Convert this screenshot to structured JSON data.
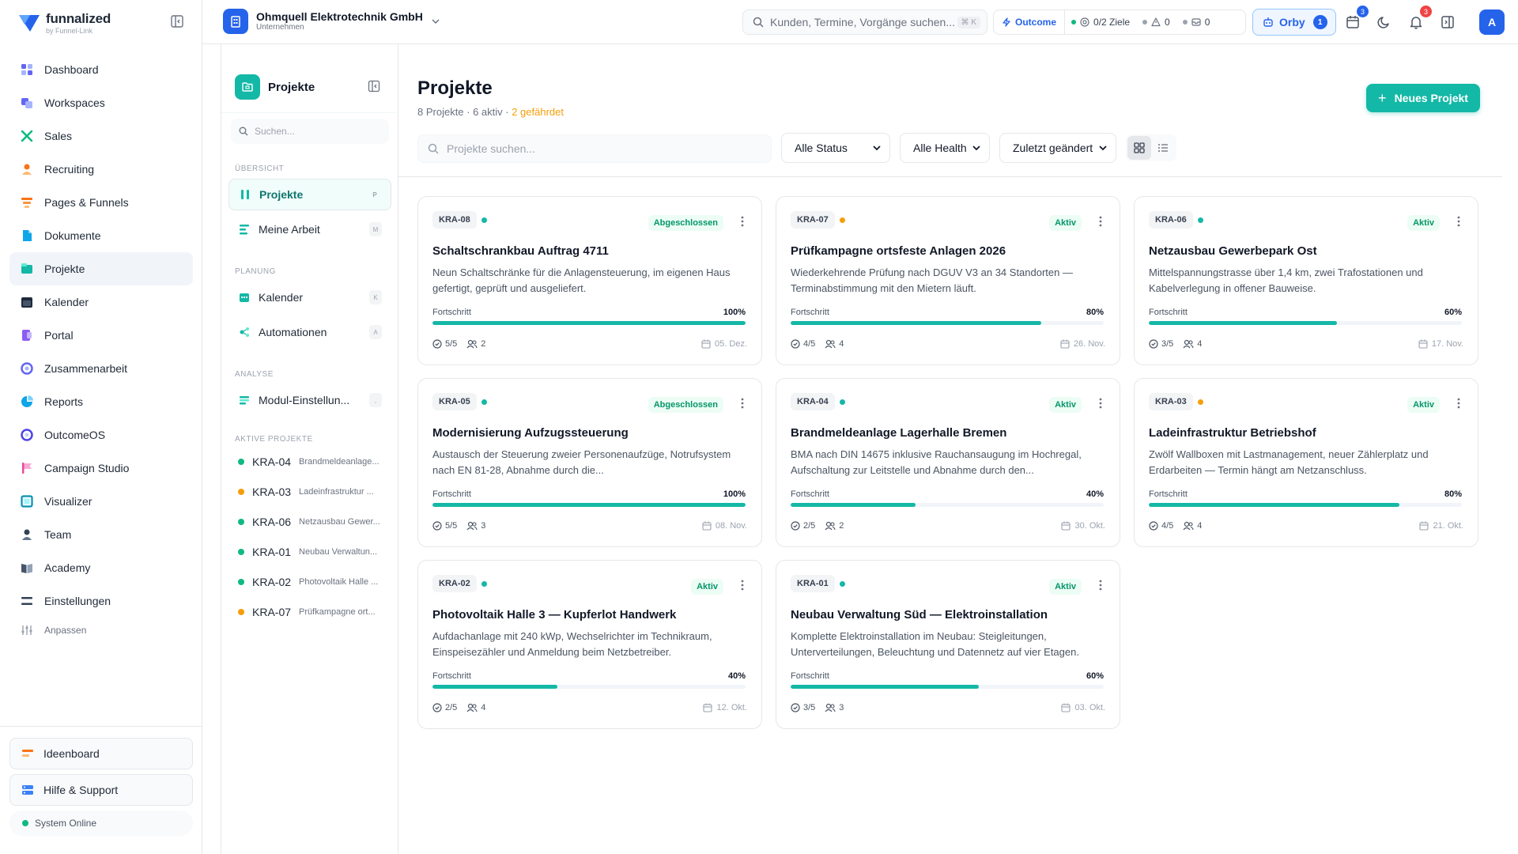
{
  "brand": {
    "name": "funnalized",
    "sub": "by Funnel-Link"
  },
  "nav": [
    {
      "label": "Dashboard",
      "icon": "dashboard-icon"
    },
    {
      "label": "Workspaces",
      "icon": "workspaces-icon"
    },
    {
      "label": "Sales",
      "icon": "sales-icon"
    },
    {
      "label": "Recruiting",
      "icon": "recruiting-icon"
    },
    {
      "label": "Pages & Funnels",
      "icon": "funnel-icon"
    },
    {
      "label": "Dokumente",
      "icon": "document-icon"
    },
    {
      "label": "Projekte",
      "icon": "projects-icon"
    },
    {
      "label": "Kalender",
      "icon": "calendar-icon"
    },
    {
      "label": "Portal",
      "icon": "portal-icon"
    },
    {
      "label": "Zusammenarbeit",
      "icon": "collaboration-icon"
    },
    {
      "label": "Reports",
      "icon": "reports-icon"
    },
    {
      "label": "OutcomeOS",
      "icon": "outcome-icon"
    },
    {
      "label": "Campaign Studio",
      "icon": "campaign-icon"
    },
    {
      "label": "Visualizer",
      "icon": "visualizer-icon"
    },
    {
      "label": "Team",
      "icon": "team-icon"
    },
    {
      "label": "Academy",
      "icon": "academy-icon"
    },
    {
      "label": "Einstellungen",
      "icon": "settings-icon"
    },
    {
      "label": "Anpassen",
      "icon": "customize-icon"
    }
  ],
  "sidebar_bottom": {
    "ideenboard": "Ideenboard",
    "help": "Hilfe & Support",
    "system": "System Online"
  },
  "topbar": {
    "company_name": "Ohmquell Elektrotechnik GmbH",
    "company_sub": "Unternehmen",
    "search_placeholder": "Kunden, Termine, Vorgänge suchen...",
    "search_shortcut": "⌘ K",
    "outcome": "Outcome",
    "goals": "0/2 Ziele",
    "warnings": "0",
    "messages": "0",
    "orby": "Orby",
    "orby_count": "1",
    "calendar_badge": "3",
    "notif_badge": "3",
    "avatar": "A"
  },
  "sub_sidebar": {
    "title": "Projekte",
    "search_placeholder": "Suchen...",
    "sections": {
      "overview": "Übersicht",
      "planning": "Planung",
      "analysis": "Analyse",
      "active": "Aktive Projekte"
    },
    "items": {
      "projekte": {
        "label": "Projekte",
        "key": "P"
      },
      "meine_arbeit": {
        "label": "Meine Arbeit",
        "key": "M"
      },
      "kalender": {
        "label": "Kalender",
        "key": "K"
      },
      "automationen": {
        "label": "Automationen",
        "key": "A"
      },
      "modul": {
        "label": "Modul-Einstellun...",
        "key": ","
      }
    },
    "active_projects": [
      {
        "code": "KRA-04",
        "name": "Brandmeldeanlage...",
        "color": "#10b981"
      },
      {
        "code": "KRA-03",
        "name": "Ladeinfrastruktur ...",
        "color": "#f59e0b"
      },
      {
        "code": "KRA-06",
        "name": "Netzausbau Gewer...",
        "color": "#10b981"
      },
      {
        "code": "KRA-01",
        "name": "Neubau Verwaltun...",
        "color": "#10b981"
      },
      {
        "code": "KRA-02",
        "name": "Photovoltaik Halle ...",
        "color": "#10b981"
      },
      {
        "code": "KRA-07",
        "name": "Prüfkampagne ort...",
        "color": "#f59e0b"
      }
    ]
  },
  "main": {
    "title": "Projekte",
    "subtitle_prefix": "8 Projekte · 6 aktiv · ",
    "subtitle_warn": "2 gefährdet",
    "new_button": "Neues Projekt",
    "search_placeholder": "Projekte suchen...",
    "filter_status": "Alle Status",
    "filter_health": "Alle Health",
    "sort": "Zuletzt geändert",
    "progress_label": "Fortschritt"
  },
  "projects": [
    {
      "code": "KRA-08",
      "health": "#14b8a6",
      "status": "Abgeschlossen",
      "title": "Schaltschrankbau Auftrag 4711",
      "desc": "Neun Schaltschränke für die Anlagensteuerung, im eigenen Haus gefertigt, geprüft und ausgeliefert.",
      "progress": 100,
      "progress_text": "100%",
      "tasks": "5/5",
      "members": "2",
      "date": "05. Dez."
    },
    {
      "code": "KRA-07",
      "health": "#f59e0b",
      "status": "Aktiv",
      "title": "Prüfkampagne ortsfeste Anlagen 2026",
      "desc": "Wiederkehrende Prüfung nach DGUV V3 an 34 Standorten — Terminabstimmung mit den Mietern läuft.",
      "progress": 80,
      "progress_text": "80%",
      "tasks": "4/5",
      "members": "4",
      "date": "26. Nov."
    },
    {
      "code": "KRA-06",
      "health": "#14b8a6",
      "status": "Aktiv",
      "title": "Netzausbau Gewerbepark Ost",
      "desc": "Mittelspannungstrasse über 1,4 km, zwei Trafostationen und Kabelverlegung in offener Bauweise.",
      "progress": 60,
      "progress_text": "60%",
      "tasks": "3/5",
      "members": "4",
      "date": "17. Nov."
    },
    {
      "code": "KRA-05",
      "health": "#14b8a6",
      "status": "Abgeschlossen",
      "title": "Modernisierung Aufzugssteuerung",
      "desc": "Austausch der Steuerung zweier Personenaufzüge, Notrufsystem nach EN 81-28, Abnahme durch die...",
      "progress": 100,
      "progress_text": "100%",
      "tasks": "5/5",
      "members": "3",
      "date": "08. Nov."
    },
    {
      "code": "KRA-04",
      "health": "#14b8a6",
      "status": "Aktiv",
      "title": "Brandmeldeanlage Lagerhalle Bremen",
      "desc": "BMA nach DIN 14675 inklusive Rauchansaugung im Hochregal, Aufschaltung zur Leitstelle und Abnahme durch den...",
      "progress": 40,
      "progress_text": "40%",
      "tasks": "2/5",
      "members": "2",
      "date": "30. Okt."
    },
    {
      "code": "KRA-03",
      "health": "#f59e0b",
      "status": "Aktiv",
      "title": "Ladeinfrastruktur Betriebshof",
      "desc": "Zwölf Wallboxen mit Lastmanagement, neuer Zählerplatz und Erdarbeiten — Termin hängt am Netzanschluss.",
      "progress": 80,
      "progress_text": "80%",
      "tasks": "4/5",
      "members": "4",
      "date": "21. Okt."
    },
    {
      "code": "KRA-02",
      "health": "#14b8a6",
      "status": "Aktiv",
      "title": "Photovoltaik Halle 3 — Kupferlot Handwerk",
      "desc": "Aufdachanlage mit 240 kWp, Wechselrichter im Technikraum, Einspeisezähler und Anmeldung beim Netzbetreiber.",
      "progress": 40,
      "progress_text": "40%",
      "tasks": "2/5",
      "members": "4",
      "date": "12. Okt."
    },
    {
      "code": "KRA-01",
      "health": "#14b8a6",
      "status": "Aktiv",
      "title": "Neubau Verwaltung Süd — Elektroinstallation",
      "desc": "Komplette Elektroinstallation im Neubau: Steigleitungen, Unterverteilungen, Beleuchtung und Datennetz auf vier Etagen.",
      "progress": 60,
      "progress_text": "60%",
      "tasks": "3/5",
      "members": "3",
      "date": "03. Okt."
    }
  ],
  "colors": {
    "accent": "#14b8a6",
    "brand": "#2563eb",
    "warning": "#f59e0b",
    "success": "#10b981"
  }
}
